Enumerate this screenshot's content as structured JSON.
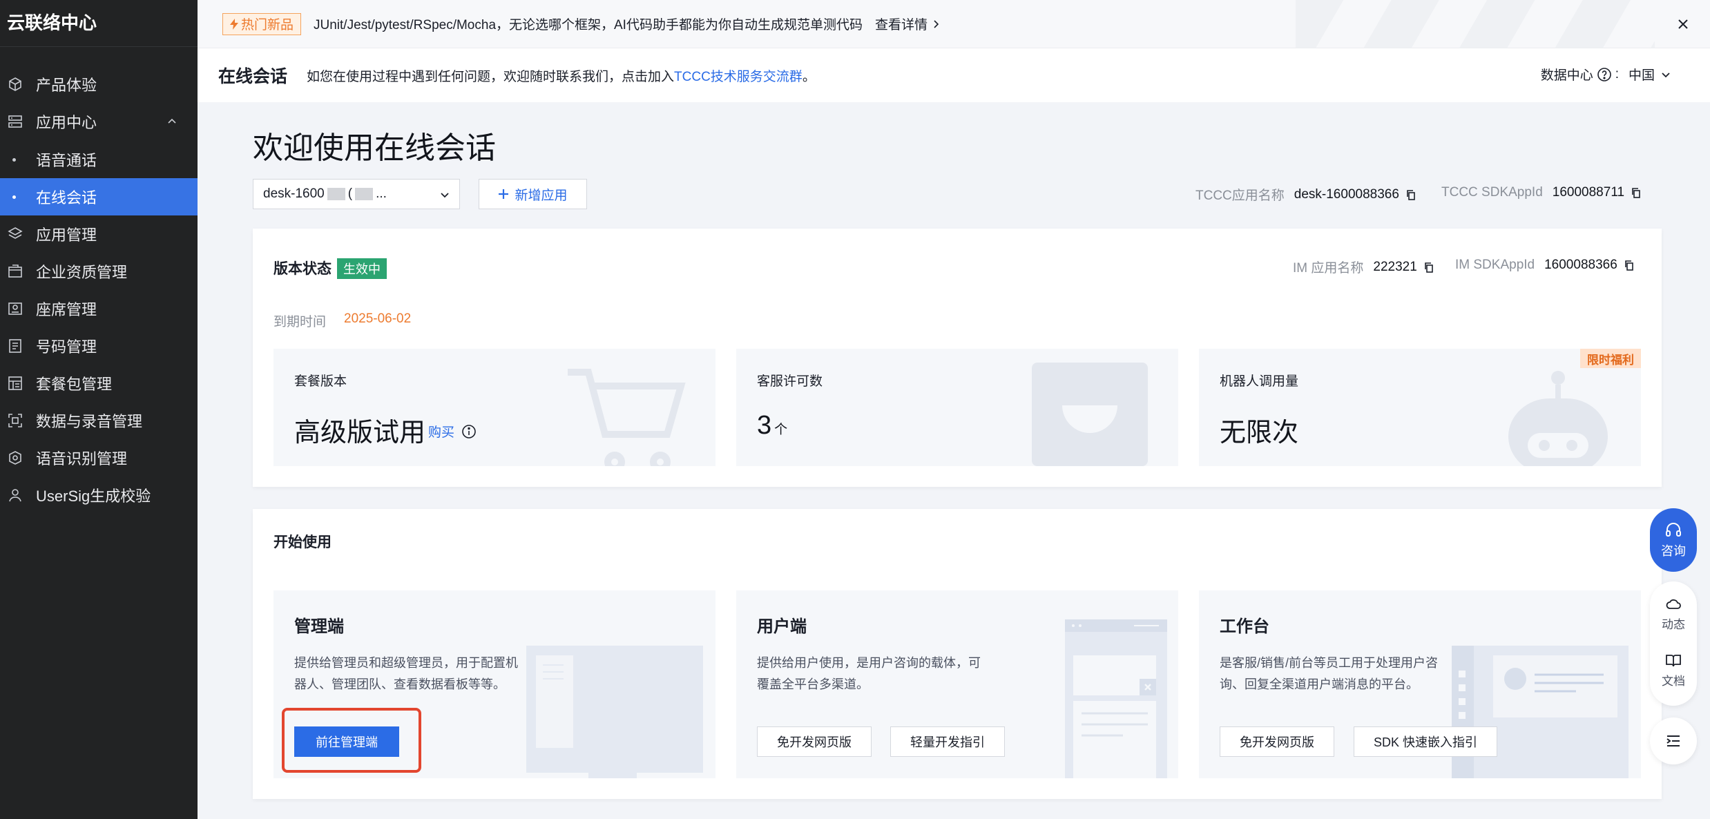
{
  "sidebar": {
    "brand": "云联络中心",
    "items": [
      {
        "label": "产品体验",
        "icon": "cube-icon"
      },
      {
        "label": "应用中心",
        "icon": "app-center-icon"
      },
      {
        "label": "语音通话",
        "icon": "dot"
      },
      {
        "label": "在线会话",
        "icon": "dot",
        "active": true
      },
      {
        "label": "应用管理",
        "icon": "layers-icon"
      },
      {
        "label": "企业资质管理",
        "icon": "folder-icon"
      },
      {
        "label": "座席管理",
        "icon": "seat-icon"
      },
      {
        "label": "号码管理",
        "icon": "number-icon"
      },
      {
        "label": "套餐包管理",
        "icon": "package-icon"
      },
      {
        "label": "数据与录音管理",
        "icon": "data-icon"
      },
      {
        "label": "语音识别管理",
        "icon": "voice-recognition-icon"
      },
      {
        "label": "UserSig生成校验",
        "icon": "user-icon"
      }
    ]
  },
  "promo": {
    "tag": "热门新品",
    "text": "JUnit/Jest/pytest/RSpec/Mocha，无论选哪个框架，AI代码助手都能为你自动生成规范单测代码",
    "link": "查看详情"
  },
  "header": {
    "title": "在线会话",
    "desc_prefix": "如您在使用过程中遇到任何问题，欢迎随时联系我们，点击加入",
    "desc_link": "TCCC技术服务交流群",
    "desc_suffix": "。",
    "data_center_label": "数据中心",
    "data_center_colon": ":",
    "region": "中国"
  },
  "welcome": {
    "title": "欢迎使用在线会话",
    "app_select_prefix": "desk-1600",
    "app_select_mid": "(",
    "app_select_suffix": "...",
    "new_app": "新增应用",
    "tccc_app_name_label": "TCCC应用名称",
    "tccc_app_name": "desk-1600088366",
    "tccc_sdkappid_label": "TCCC SDKAppId",
    "tccc_sdkappid": "1600088711"
  },
  "version": {
    "label": "版本状态",
    "status": "生效中",
    "im_name_label": "IM 应用名称",
    "im_name": "222321",
    "im_sdkappid_label": "IM SDKAppId",
    "im_sdkappid": "1600088366",
    "expire_label": "到期时间",
    "expire_date": "2025-06-02",
    "stats": [
      {
        "label": "套餐版本",
        "value": "高级版试用",
        "action": "购买"
      },
      {
        "label": "客服许可数",
        "value": "3",
        "unit": "个"
      },
      {
        "label": "机器人调用量",
        "value": "无限次",
        "badge": "限时福利"
      }
    ]
  },
  "start": {
    "title": "开始使用",
    "panels": [
      {
        "title": "管理端",
        "desc": "提供给管理员和超级管理员，用于配置机器人、管理团队、查看数据看板等等。",
        "buttons": [
          "前往管理端"
        ]
      },
      {
        "title": "用户端",
        "desc": "提供给用户使用，是用户咨询的载体，可覆盖全平台多渠道。",
        "buttons": [
          "免开发网页版",
          "轻量开发指引"
        ]
      },
      {
        "title": "工作台",
        "desc": "是客服/销售/前台等员工用于处理用户咨询、回复全渠道用户端消息的平台。",
        "buttons": [
          "免开发网页版",
          "SDK 快速嵌入指引"
        ]
      }
    ]
  },
  "float": {
    "consult": "咨询",
    "news": "动态",
    "docs": "文档"
  },
  "colors": {
    "accent": "#2b6ce6",
    "sidebar_bg": "#222324",
    "active": "#3773e4",
    "success": "#2ba471",
    "warning": "#ed7b2f",
    "highlight": "#e3462f"
  }
}
